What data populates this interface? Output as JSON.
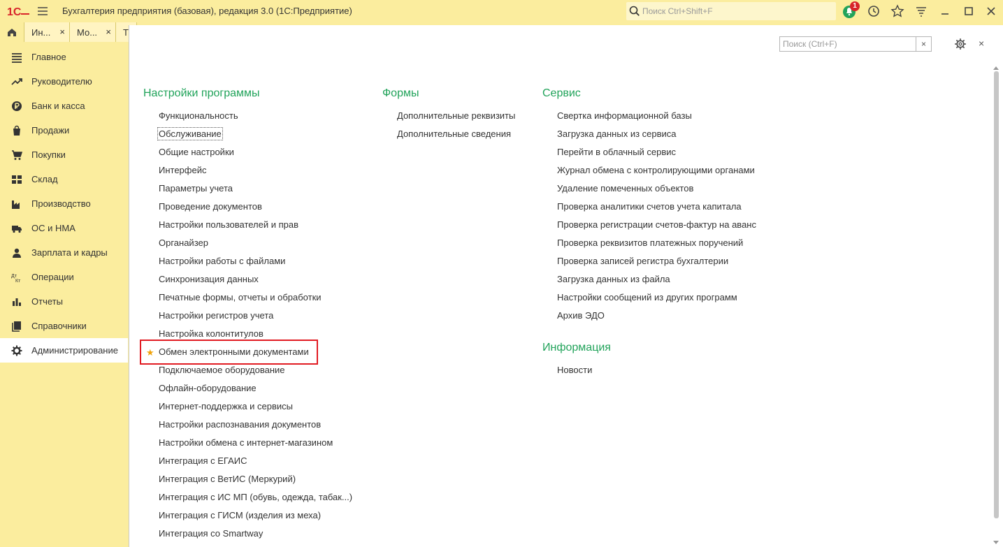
{
  "app": {
    "title": "Бухгалтерия предприятия (базовая), редакция 3.0  (1С:Предприятие)",
    "search_placeholder": "Поиск Ctrl+Shift+F",
    "notification_count": "1"
  },
  "tabs": [
    {
      "label": "Ин...",
      "close": "×"
    },
    {
      "label": "Мо...",
      "close": "×"
    },
    {
      "label": "Т",
      "close": ""
    }
  ],
  "sidebar": {
    "items": [
      {
        "label": "Главное",
        "icon": "list-icon"
      },
      {
        "label": "Руководителю",
        "icon": "trend-icon"
      },
      {
        "label": "Банк и касса",
        "icon": "ruble-icon"
      },
      {
        "label": "Продажи",
        "icon": "bag-icon"
      },
      {
        "label": "Покупки",
        "icon": "cart-icon"
      },
      {
        "label": "Склад",
        "icon": "warehouse-icon"
      },
      {
        "label": "Производство",
        "icon": "factory-icon"
      },
      {
        "label": "ОС и НМА",
        "icon": "truck-icon"
      },
      {
        "label": "Зарплата и кадры",
        "icon": "person-icon"
      },
      {
        "label": "Операции",
        "icon": "dt-kt-icon"
      },
      {
        "label": "Отчеты",
        "icon": "bar-chart-icon"
      },
      {
        "label": "Справочники",
        "icon": "book-icon"
      },
      {
        "label": "Администрирование",
        "icon": "gear-icon"
      }
    ],
    "active_index": 12
  },
  "panel": {
    "search_placeholder": "Поиск (Ctrl+F)",
    "search_clear": "×",
    "close": "×",
    "sections": {
      "settings": {
        "title": "Настройки программы",
        "links": [
          "Функциональность",
          "Обслуживание",
          "Общие настройки",
          "Интерфейс",
          "Параметры учета",
          "Проведение документов",
          "Настройки пользователей и прав",
          "Органайзер",
          "Настройки работы с файлами",
          "Синхронизация данных",
          "Печатные формы, отчеты и обработки",
          "Настройки регистров учета",
          "Настройка колонтитулов",
          "Обмен электронными документами",
          "Подключаемое оборудование",
          "Офлайн-оборудование",
          "Интернет-поддержка и сервисы",
          "Настройки распознавания документов",
          "Настройки обмена с интернет-магазином",
          "Интеграция с ЕГАИС",
          "Интеграция с ВетИС (Меркурий)",
          "Интеграция с ИС МП (обувь, одежда, табак...)",
          "Интеграция с ГИСМ (изделия из меха)",
          "Интеграция со Smartway"
        ]
      },
      "forms": {
        "title": "Формы",
        "links": [
          "Дополнительные реквизиты",
          "Дополнительные сведения"
        ]
      },
      "service": {
        "title": "Сервис",
        "links": [
          "Свертка информационной базы",
          "Загрузка данных из сервиса",
          "Перейти в облачный сервис",
          "Журнал обмена с контролирующими органами",
          "Удаление помеченных объектов",
          "Проверка аналитики счетов учета капитала",
          "Проверка регистрации счетов-фактур на аванс",
          "Проверка реквизитов платежных поручений",
          "Проверка записей регистра бухгалтерии",
          "Загрузка данных из файла",
          "Настройки сообщений из других программ",
          "Архив ЭДО"
        ]
      },
      "info": {
        "title": "Информация",
        "links": [
          "Новости"
        ]
      }
    },
    "star": "★",
    "colors": {
      "section_title": "#21a35a",
      "highlight": "#e11b22",
      "star": "#f0a30a",
      "sidebar_bg": "#fbed9e"
    }
  }
}
